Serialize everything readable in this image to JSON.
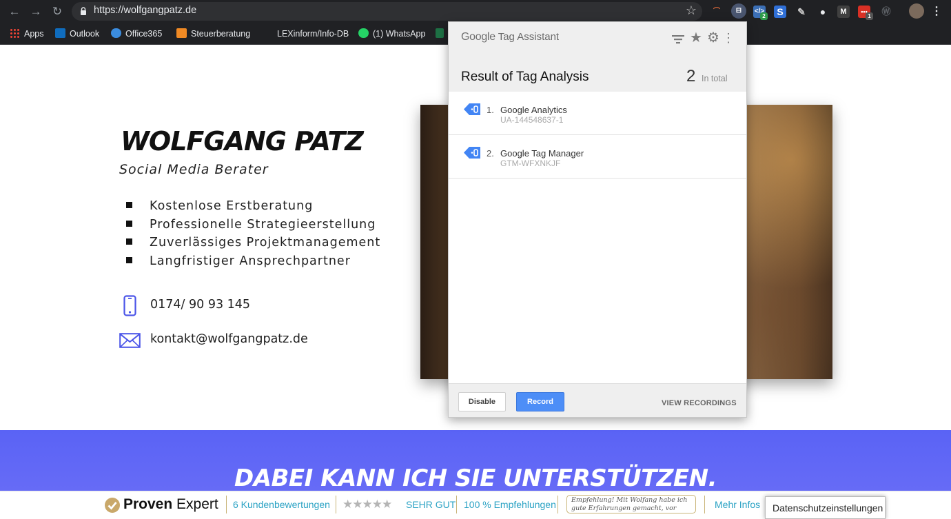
{
  "browser": {
    "url": "https://wolfgangpatz.de",
    "bookmarks": [
      {
        "label": "Apps"
      },
      {
        "label": "Outlook"
      },
      {
        "label": "Office365"
      },
      {
        "label": "Steuerberatung"
      },
      {
        "label": "LEXinform/Info-DB"
      },
      {
        "label": "(1) WhatsApp"
      }
    ],
    "extension_badges": {
      "code_ext": "2",
      "red_ext": "1"
    },
    "colors": {
      "chrome_bg": "#202124",
      "url_bg": "#2f3033"
    }
  },
  "page": {
    "name": "WOLFGANG PATZ",
    "subtitle": "Social Media Berater",
    "features": [
      "Kostenlose Erstberatung",
      "Professionelle Strategieerstellung",
      "Zuverlässiges Projektmanagement",
      "Langfristiger Ansprechpartner"
    ],
    "phone": "0174/ 90 93 145",
    "email": "kontakt@wolfgangpatz.de",
    "banner_title": "DABEI KANN ICH SIE UNTERSTÜTZEN.",
    "accent_color": "#5a63f5"
  },
  "proven_expert": {
    "brand_bold": "Proven",
    "brand_light": "Expert",
    "reviews": "6 Kundenbewertungen",
    "stars": "★★★★★",
    "rating": "SEHR GUT",
    "recommend": "100 % Empfehlungen",
    "quote": "Empfehlung! Mit Wolfang habe ich gute Erfahrungen gemacht, vor alle...",
    "more": "Mehr Infos",
    "privacy_button": "Datenschutzeinstellungen"
  },
  "tag_assistant": {
    "logo_google": "Google",
    "logo_rest": "Tag Assistant",
    "result_title": "Result of Tag Analysis",
    "total_count": "2",
    "total_label": "In total",
    "tags": [
      {
        "num": "1.",
        "name": "Google Analytics",
        "id": "UA-144548637-1"
      },
      {
        "num": "2.",
        "name": "Google Tag Manager",
        "id": "GTM-WFXNKJF"
      }
    ],
    "disable_label": "Disable",
    "record_label": "Record",
    "view_recordings_label": "VIEW RECORDINGS",
    "icons": [
      "filter-icon",
      "star-icon",
      "gear-icon",
      "more-vert-icon"
    ]
  }
}
